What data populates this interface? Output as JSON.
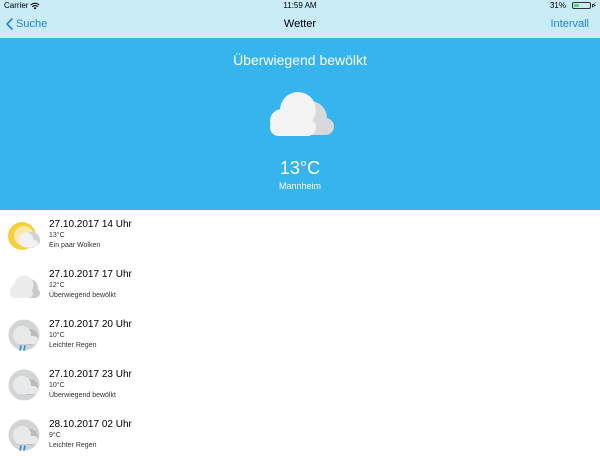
{
  "status_bar": {
    "carrier": "Carrier",
    "time": "11:59 AM",
    "battery_percent": "31%",
    "battery_level": 0.31,
    "wifi_icon": "wifi-icon",
    "charging_icon": "charging-bolt-icon"
  },
  "nav": {
    "back_label": "Suche",
    "title": "Wetter",
    "right_label": "Intervall"
  },
  "current": {
    "condition": "Überwiegend bewölkt",
    "icon": "cloud-icon",
    "temperature": "13°C",
    "city": "Mannheim"
  },
  "forecast": [
    {
      "datetime": "27.10.2017 14 Uhr",
      "temp": "13°C",
      "description": "Ein paar Wolken",
      "icon": "sun-cloud-icon"
    },
    {
      "datetime": "27.10.2017 17 Uhr",
      "temp": "12°C",
      "description": "Überwiegend bewölkt",
      "icon": "cloud-icon"
    },
    {
      "datetime": "27.10.2017 20 Uhr",
      "temp": "10°C",
      "description": "Leichter Regen",
      "icon": "rain-icon"
    },
    {
      "datetime": "27.10.2017 23 Uhr",
      "temp": "10°C",
      "description": "Überwiegend bewölkt",
      "icon": "dark-cloud-icon"
    },
    {
      "datetime": "28.10.2017 02 Uhr",
      "temp": "9°C",
      "description": "Leichter Regen",
      "icon": "rain-icon"
    }
  ],
  "colors": {
    "nav_background": "#c9ecf7",
    "hero_background": "#35b4ee",
    "link": "#1c86e3",
    "sun": "#f6cf3c"
  }
}
